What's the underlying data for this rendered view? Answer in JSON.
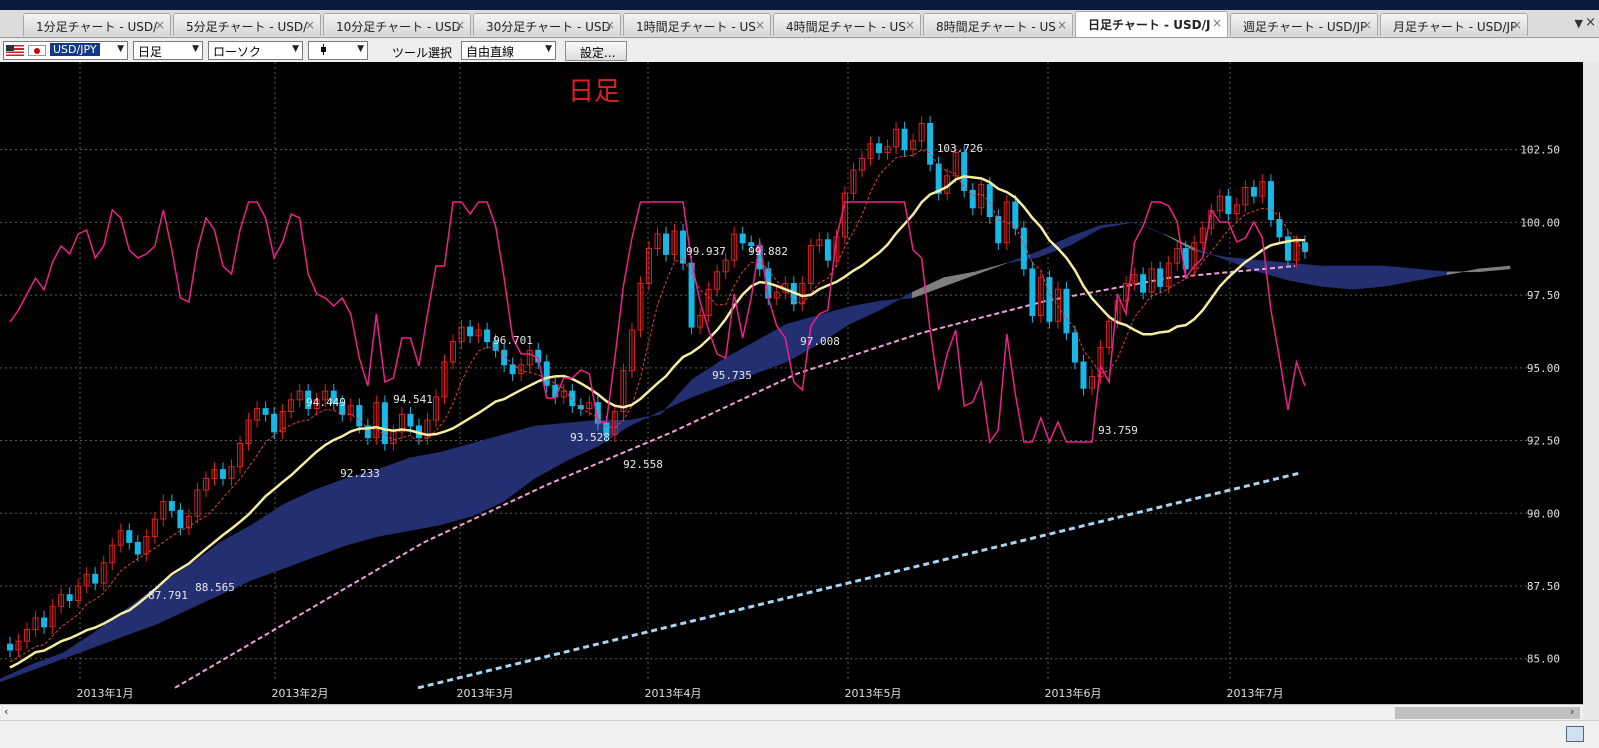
{
  "tabs": [
    {
      "label": "1分足チャート - USD/"
    },
    {
      "label": "5分足チャート - USD/"
    },
    {
      "label": "10分足チャート - USD"
    },
    {
      "label": "30分足チャート - USD"
    },
    {
      "label": "1時間足チャート - US"
    },
    {
      "label": "4時間足チャート - US"
    },
    {
      "label": "8時間足チャート - US"
    },
    {
      "label": "日足チャート - USD/J"
    },
    {
      "label": "週足チャート - USD/JP"
    },
    {
      "label": "月足チャート - USD/JP"
    }
  ],
  "active_tab_index": 7,
  "tab_close_glyph": "×",
  "tab_menu_glyph": "▼",
  "window_close_glyph": "×",
  "toolbar": {
    "symbol": "USD/JPY",
    "timeframe": "日足",
    "chart_type": "ローソク",
    "tool_label": "ツール選択",
    "draw_tool": "自由直線",
    "settings_button": "設定..."
  },
  "chart_title": "日足",
  "colors": {
    "background": "#000000",
    "up": "#e0201c",
    "down": "#16b8e8",
    "kumo_up": "#232f70",
    "kumo_dn": "#7f7f7f",
    "ma": "#f4eda0",
    "rsi": "#f0208a",
    "ma_long": "#f0a0d8",
    "trend": "#a8d4f0",
    "tenkan": "#e04040"
  },
  "chart_data": {
    "type": "candlestick",
    "symbol": "USD/JPY",
    "timeframe": "日足",
    "y_axis": {
      "ticks": [
        "85.00",
        "87.50",
        "90.00",
        "92.50",
        "95.00",
        "97.50",
        "100.00",
        "102.50"
      ],
      "ylim": [
        84.2,
        105.1
      ]
    },
    "x_axis": {
      "labels": [
        "2013年1月",
        "2013年2月",
        "2013年3月",
        "2013年4月",
        "2013年5月",
        "2013年6月",
        "2013年7月"
      ]
    },
    "annotations": [
      "103.726",
      "99.937",
      "99.882",
      "96.701",
      "94.449",
      "94.541",
      "92.233",
      "93.528",
      "92.558",
      "95.735",
      "97.008",
      "87.791",
      "88.565",
      "93.759"
    ],
    "candles_approx": [
      [
        85.5,
        85.3
      ],
      [
        85.3,
        85.6
      ],
      [
        85.6,
        86.0
      ],
      [
        86.0,
        86.4
      ],
      [
        86.4,
        86.1
      ],
      [
        86.1,
        86.8
      ],
      [
        86.8,
        87.2
      ],
      [
        87.2,
        87.0
      ],
      [
        87.0,
        87.5
      ],
      [
        87.5,
        87.9
      ],
      [
        87.9,
        87.6
      ],
      [
        87.6,
        88.3
      ],
      [
        88.3,
        88.9
      ],
      [
        88.9,
        89.4
      ],
      [
        89.4,
        89.0
      ],
      [
        89.0,
        88.6
      ],
      [
        88.6,
        89.2
      ],
      [
        89.2,
        89.8
      ],
      [
        89.8,
        90.4
      ],
      [
        90.4,
        90.1
      ],
      [
        90.1,
        89.5
      ],
      [
        89.5,
        89.9
      ],
      [
        89.9,
        90.8
      ],
      [
        90.8,
        91.2
      ],
      [
        91.2,
        91.5
      ],
      [
        91.5,
        91.2
      ],
      [
        91.2,
        91.6
      ],
      [
        91.6,
        92.4
      ],
      [
        92.4,
        93.2
      ],
      [
        93.2,
        93.6
      ],
      [
        93.6,
        93.4
      ],
      [
        93.4,
        92.8
      ],
      [
        92.8,
        93.5
      ],
      [
        93.5,
        93.9
      ],
      [
        93.9,
        94.2
      ],
      [
        94.2,
        93.6
      ],
      [
        93.6,
        93.9
      ],
      [
        93.9,
        94.2
      ],
      [
        94.2,
        93.8
      ],
      [
        93.8,
        93.4
      ],
      [
        93.4,
        93.7
      ],
      [
        93.7,
        93.0
      ],
      [
        93.0,
        92.6
      ],
      [
        92.6,
        93.8
      ],
      [
        93.8,
        92.4
      ],
      [
        92.4,
        92.8
      ],
      [
        92.8,
        93.4
      ],
      [
        93.4,
        93.0
      ],
      [
        93.0,
        92.6
      ],
      [
        92.6,
        93.2
      ],
      [
        93.2,
        94.0
      ],
      [
        94.0,
        95.2
      ],
      [
        95.2,
        95.9
      ],
      [
        95.9,
        96.4
      ],
      [
        96.4,
        96.1
      ],
      [
        96.1,
        96.3
      ],
      [
        96.3,
        95.9
      ],
      [
        95.9,
        95.6
      ],
      [
        95.6,
        95.1
      ],
      [
        95.1,
        94.8
      ],
      [
        94.8,
        95.1
      ],
      [
        95.1,
        95.6
      ],
      [
        95.6,
        95.2
      ],
      [
        95.2,
        94.4
      ],
      [
        94.4,
        94.0
      ],
      [
        94.0,
        94.2
      ],
      [
        94.2,
        93.7
      ],
      [
        93.7,
        93.6
      ],
      [
        93.6,
        93.8
      ],
      [
        93.8,
        93.1
      ],
      [
        93.1,
        92.7
      ],
      [
        92.7,
        93.5
      ],
      [
        93.5,
        94.9
      ],
      [
        94.9,
        96.3
      ],
      [
        96.3,
        97.9
      ],
      [
        97.9,
        99.1
      ],
      [
        99.1,
        99.6
      ],
      [
        99.6,
        98.9
      ],
      [
        98.9,
        99.7
      ],
      [
        99.7,
        98.6
      ],
      [
        98.6,
        96.4
      ],
      [
        96.4,
        96.8
      ],
      [
        96.8,
        97.7
      ],
      [
        97.7,
        98.3
      ],
      [
        98.3,
        98.7
      ],
      [
        98.7,
        99.6
      ],
      [
        99.6,
        99.3
      ],
      [
        99.3,
        99.2
      ],
      [
        99.2,
        98.4
      ],
      [
        98.4,
        97.4
      ],
      [
        97.4,
        97.6
      ],
      [
        97.6,
        97.9
      ],
      [
        97.9,
        97.2
      ],
      [
        97.2,
        97.9
      ],
      [
        97.9,
        99.2
      ],
      [
        99.2,
        99.4
      ],
      [
        99.4,
        98.7
      ],
      [
        98.7,
        99.5
      ],
      [
        99.5,
        101.0
      ],
      [
        101.0,
        101.8
      ],
      [
        101.8,
        102.2
      ],
      [
        102.2,
        102.7
      ],
      [
        102.7,
        102.4
      ],
      [
        102.4,
        102.6
      ],
      [
        102.6,
        103.2
      ],
      [
        103.2,
        102.5
      ],
      [
        102.5,
        102.8
      ],
      [
        102.8,
        103.4
      ],
      [
        103.4,
        102.0
      ],
      [
        102.0,
        101.0
      ],
      [
        101.0,
        101.6
      ],
      [
        101.6,
        102.4
      ],
      [
        102.4,
        101.1
      ],
      [
        101.1,
        100.5
      ],
      [
        100.5,
        101.3
      ],
      [
        101.3,
        100.2
      ],
      [
        100.2,
        99.3
      ],
      [
        99.3,
        100.7
      ],
      [
        100.7,
        99.8
      ],
      [
        99.8,
        98.4
      ],
      [
        98.4,
        96.8
      ],
      [
        96.8,
        98.1
      ],
      [
        98.1,
        96.6
      ],
      [
        96.6,
        97.7
      ],
      [
        97.7,
        96.2
      ],
      [
        96.2,
        95.2
      ],
      [
        95.2,
        94.3
      ],
      [
        94.3,
        94.7
      ],
      [
        94.7,
        95.7
      ],
      [
        95.7,
        96.6
      ],
      [
        96.6,
        97.3
      ],
      [
        97.3,
        97.9
      ],
      [
        97.9,
        98.2
      ],
      [
        98.2,
        97.6
      ],
      [
        97.6,
        98.4
      ],
      [
        98.4,
        97.8
      ],
      [
        97.8,
        98.6
      ],
      [
        98.6,
        99.1
      ],
      [
        99.1,
        98.4
      ],
      [
        98.4,
        99.3
      ],
      [
        99.3,
        99.8
      ],
      [
        99.8,
        100.4
      ],
      [
        100.4,
        100.9
      ],
      [
        100.9,
        100.3
      ],
      [
        100.3,
        100.6
      ],
      [
        100.6,
        101.2
      ],
      [
        101.2,
        100.9
      ],
      [
        100.9,
        101.4
      ],
      [
        101.4,
        100.1
      ],
      [
        100.1,
        99.5
      ],
      [
        99.5,
        98.7
      ],
      [
        98.7,
        99.3
      ],
      [
        99.3,
        99.0
      ]
    ],
    "kumo_span_a_approx": [
      84.3,
      84.8,
      85.2,
      85.9,
      86.7,
      87.5,
      88.2,
      89.0,
      89.6,
      90.3,
      90.8,
      91.2,
      91.5,
      91.9,
      92.1,
      92.4,
      92.7,
      93.0,
      93.1,
      93.2,
      93.2,
      93.4,
      94.6,
      95.3,
      95.9,
      96.5,
      96.8,
      97.1,
      97.3,
      97.4,
      97.8,
      98.2,
      98.6,
      99.0,
      99.5,
      99.9,
      100.0,
      99.6,
      99.0,
      98.8,
      98.7,
      98.6,
      98.5,
      98.5,
      98.5,
      98.4,
      98.3,
      98.3,
      98.4
    ],
    "kumo_span_b_approx": [
      84.2,
      84.6,
      85.0,
      85.4,
      85.8,
      86.2,
      86.7,
      87.2,
      87.7,
      88.1,
      88.5,
      88.9,
      89.2,
      89.4,
      89.6,
      89.9,
      90.4,
      91.2,
      91.8,
      92.3,
      93.0,
      93.5,
      94.0,
      94.4,
      94.8,
      95.2,
      95.8,
      96.5,
      97.0,
      97.6,
      98.1,
      98.3,
      98.6,
      98.8,
      99.2,
      99.8,
      100.0,
      99.6,
      99.1,
      98.7,
      98.3,
      98.0,
      97.8,
      97.7,
      97.8,
      98.0,
      98.2,
      98.4,
      98.5
    ],
    "ma_long_approx": [
      84.0,
      86.5,
      89.0,
      91.0,
      92.8,
      94.8,
      96.2,
      97.3,
      98.1,
      98.5
    ],
    "trend_line": [
      [
        84.0,
        "2013年3月"
      ],
      [
        91.4,
        "2013年7月"
      ]
    ]
  }
}
